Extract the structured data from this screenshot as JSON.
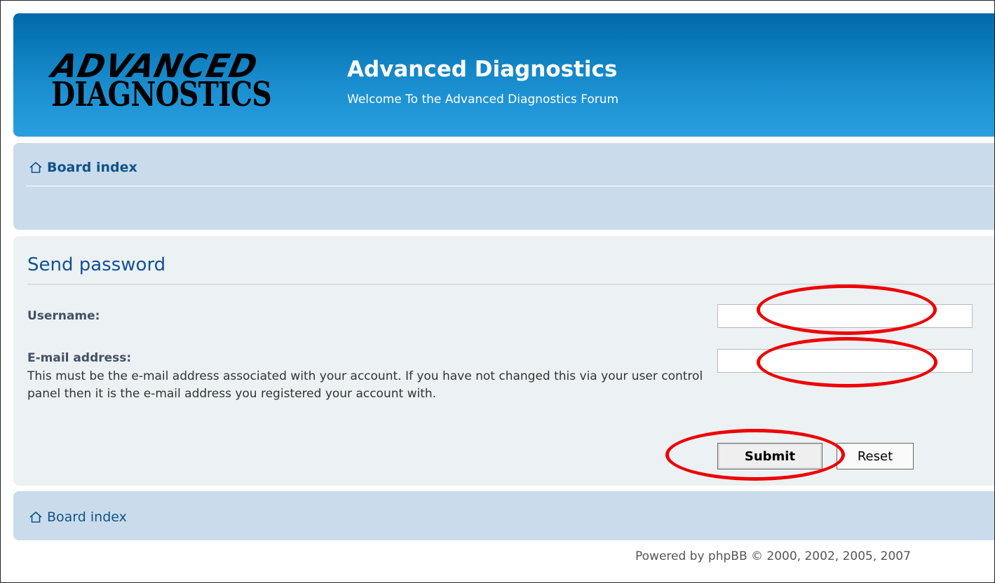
{
  "header": {
    "logo_top": "ADVANCED",
    "logo_bottom": "DIAGNOSTICS",
    "title": "Advanced Diagnostics",
    "description": "Welcome To the Advanced Diagnostics Forum"
  },
  "nav": {
    "breadcrumb": "Board index",
    "icon": "home-icon"
  },
  "form": {
    "heading": "Send password",
    "username_label": "Username:",
    "username_value": "",
    "email_label": "E-mail address:",
    "email_value": "",
    "email_explain": "This must be the e-mail address associated with your account. If you have not changed this via your user control panel then it is the e-mail address you registered your account with.",
    "submit_label": "Submit",
    "reset_label": "Reset"
  },
  "footer": {
    "breadcrumb": "Board index",
    "copyright": "Powered by phpBB © 2000, 2002, 2005, 2007"
  },
  "colors": {
    "header_blue": "#006aa9",
    "nav_bg": "#cadceb",
    "panel_bg": "#ecf1f3",
    "heading": "#115098",
    "annotation": "#ee0000"
  }
}
